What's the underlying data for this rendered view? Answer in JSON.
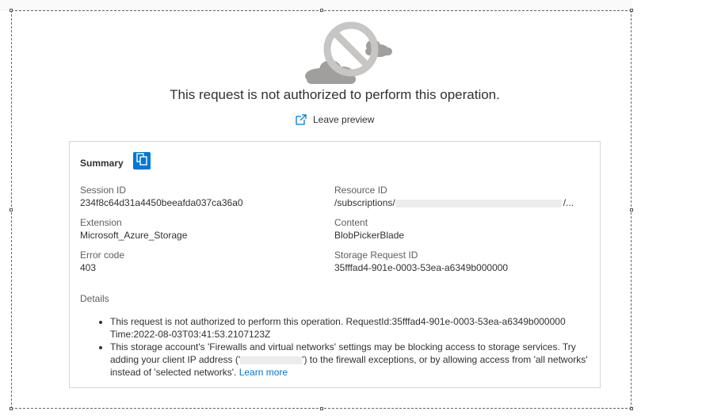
{
  "headline": "This request is not authorized to perform this operation.",
  "leave_preview": "Leave preview",
  "summary": {
    "title": "Summary",
    "session_id": {
      "label": "Session ID",
      "value": "234f8c64d31a4450beeafda037ca36a0"
    },
    "resource_id": {
      "label": "Resource ID",
      "value_prefix": "/subscriptions/",
      "value_suffix": "/..."
    },
    "extension": {
      "label": "Extension",
      "value": "Microsoft_Azure_Storage"
    },
    "content": {
      "label": "Content",
      "value": "BlobPickerBlade"
    },
    "error_code": {
      "label": "Error code",
      "value": "403"
    },
    "storage_request_id": {
      "label": "Storage Request ID",
      "value": "35fffad4-901e-0003-53ea-a6349b000000"
    }
  },
  "details": {
    "label": "Details",
    "item1_line1": "This request is not authorized to perform this operation. RequestId:35fffad4-901e-0003-53ea-a6349b000000",
    "item1_line2": "Time:2022-08-03T03:41:53.2107123Z",
    "item2_part1": "This storage account's 'Firewalls and virtual networks' settings may be blocking access to storage services. Try adding your client IP address ('",
    "item2_part2": "') to the firewall exceptions, or by allowing access from 'all networks' instead of 'selected networks'.",
    "learn_more": "Learn more"
  },
  "colors": {
    "accent": "#0078d4",
    "text": "#323130",
    "muted": "#605e5c"
  },
  "icons": {
    "hero": "blocked-cloud-icon",
    "leave_preview": "external-link-icon",
    "copy": "copy-icon"
  }
}
